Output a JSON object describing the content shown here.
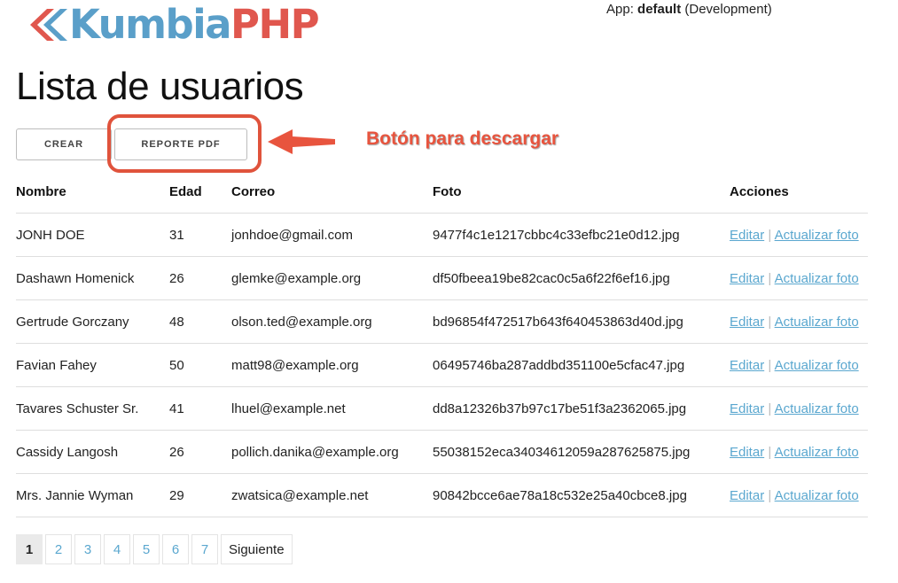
{
  "header": {
    "logo": {
      "part1": "Kumbia",
      "part2": "PHP",
      "color1": "#5a9fc9",
      "color2": "#e0574e"
    },
    "app_prefix": "App:",
    "app_name": "default",
    "app_env": "(Development)"
  },
  "page": {
    "title": "Lista de usuarios"
  },
  "toolbar": {
    "create_label": "CREAR",
    "pdf_label": "REPORTE PDF"
  },
  "annotation": {
    "text": "Botón para descargar",
    "color": "#e8543e"
  },
  "table": {
    "headers": [
      "Nombre",
      "Edad",
      "Correo",
      "Foto",
      "Acciones"
    ],
    "edit_label": "Editar",
    "separator": "|",
    "photo_label": "Actualizar foto",
    "rows": [
      {
        "name": "JONH DOE",
        "age": "31",
        "email": "jonhdoe@gmail.com",
        "photo": "9477f4c1e1217cbbc4c33efbc21e0d12.jpg"
      },
      {
        "name": "Dashawn Homenick",
        "age": "26",
        "email": "glemke@example.org",
        "photo": "df50fbeea19be82cac0c5a6f22f6ef16.jpg"
      },
      {
        "name": "Gertrude Gorczany",
        "age": "48",
        "email": "olson.ted@example.org",
        "photo": "bd96854f472517b643f640453863d40d.jpg"
      },
      {
        "name": "Favian Fahey",
        "age": "50",
        "email": "matt98@example.org",
        "photo": "06495746ba287addbd351100e5cfac47.jpg"
      },
      {
        "name": "Tavares Schuster Sr.",
        "age": "41",
        "email": "lhuel@example.net",
        "photo": "dd8a12326b37b97c17be51f3a2362065.jpg"
      },
      {
        "name": "Cassidy Langosh",
        "age": "26",
        "email": "pollich.danika@example.org",
        "photo": "55038152eca34034612059a287625875.jpg"
      },
      {
        "name": "Mrs. Jannie Wyman",
        "age": "29",
        "email": "zwatsica@example.net",
        "photo": "90842bcce6ae78a18c532e25a40cbce8.jpg"
      }
    ]
  },
  "pagination": {
    "pages": [
      "1",
      "2",
      "3",
      "4",
      "5",
      "6",
      "7"
    ],
    "current": "1",
    "next_label": "Siguiente"
  }
}
